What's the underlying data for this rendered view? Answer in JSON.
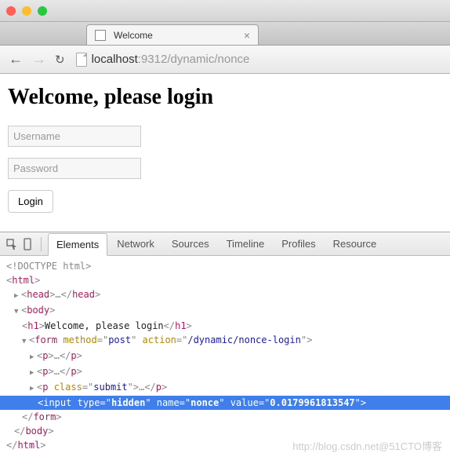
{
  "window": {
    "traffic": [
      "red",
      "yellow",
      "green"
    ]
  },
  "tab": {
    "title": "Welcome",
    "close": "×"
  },
  "toolbar": {
    "back": "←",
    "forward": "→",
    "reload": "↻"
  },
  "url": {
    "host": "localhost",
    "rest": ":9312/dynamic/nonce"
  },
  "page": {
    "heading": "Welcome, please login",
    "username_ph": "Username",
    "password_ph": "Password",
    "login_btn": "Login"
  },
  "devtools": {
    "tabs": [
      "Elements",
      "Network",
      "Sources",
      "Timeline",
      "Profiles",
      "Resource"
    ],
    "active_tab": 0
  },
  "dom": {
    "doctype": "<!DOCTYPE html>",
    "html_open": "html",
    "head": {
      "open": "head",
      "ellipsis": "…",
      "close": "head"
    },
    "body_open": "body",
    "h1": {
      "tag": "h1",
      "text": "Welcome, please login"
    },
    "form": {
      "tag": "form",
      "method_attr": "method",
      "method_val": "post",
      "action_attr": "action",
      "action_val": "/dynamic/nonce-login"
    },
    "p1": {
      "tag": "p",
      "ellipsis": "…"
    },
    "p2": {
      "tag": "p",
      "ellipsis": "…"
    },
    "p3": {
      "tag": "p",
      "class_attr": "class",
      "class_val": "submit",
      "ellipsis": "…"
    },
    "hidden": {
      "tag": "input",
      "type_attr": "type",
      "type_val": "hidden",
      "name_attr": "name",
      "name_val": "nonce",
      "value_attr": "value",
      "value_val": "0.0179961813547"
    },
    "form_close": "form",
    "body_close": "body",
    "html_close": "html"
  },
  "watermark": "http://blog.csdn.net@51CTO博客"
}
